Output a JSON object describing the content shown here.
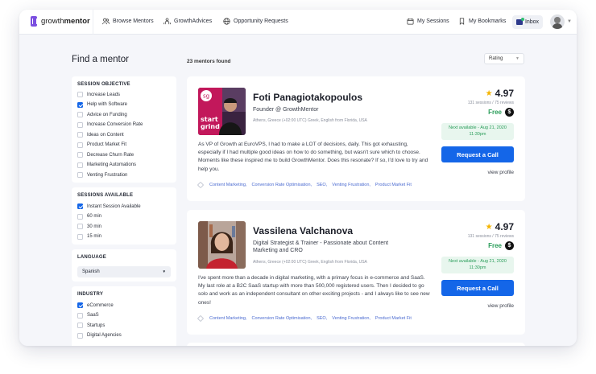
{
  "brand": {
    "name_prefix": "growth",
    "name_suffix": "mentor"
  },
  "nav": {
    "browse": "Browse Mentors",
    "advices": "GrowthAdvices",
    "opportunities": "Opportunity Requests",
    "sessions": "My Sessions",
    "bookmarks": "My Bookmarks",
    "inbox": "Inbox"
  },
  "page": {
    "title": "Find a mentor",
    "count": "23 mentors found",
    "sort": "Rating"
  },
  "filters": {
    "objective": {
      "title": "SESSION OBJECTIVE",
      "options": [
        {
          "label": "Increase Leads",
          "checked": false
        },
        {
          "label": "Help with Software",
          "checked": true
        },
        {
          "label": "Advice on Funding",
          "checked": false
        },
        {
          "label": "Increase Conversion Rate",
          "checked": false
        },
        {
          "label": "Ideas on Content",
          "checked": false
        },
        {
          "label": "Product Market Fit",
          "checked": false
        },
        {
          "label": "Decrease Churn Rate",
          "checked": false
        },
        {
          "label": "Marketing Automations",
          "checked": false
        },
        {
          "label": "Venting Frustration",
          "checked": false
        }
      ]
    },
    "available": {
      "title": "SESSIONS AVAILABLE",
      "options": [
        {
          "label": "Instant Session Available",
          "checked": true
        },
        {
          "label": "60 min",
          "checked": false
        },
        {
          "label": "30 min",
          "checked": false
        },
        {
          "label": "15 min",
          "checked": false
        }
      ]
    },
    "language": {
      "title": "LANGUAGE",
      "value": "Spanish"
    },
    "industry": {
      "title": "INDUSTRY",
      "options": [
        {
          "label": "eCommerce",
          "checked": true
        },
        {
          "label": "SaaS",
          "checked": false
        },
        {
          "label": "Startups",
          "checked": false
        },
        {
          "label": "Digital Agencies",
          "checked": false
        }
      ]
    }
  },
  "mentors": [
    {
      "name": "Foti Panagiotakopoulos",
      "role": "Founder @ GrowthMentor",
      "meta": "Athens, Greece (+02:00 UTC)   Greek, English   from Florida, USA",
      "bio": "As VP of Growth at EuroVPS, I had to make a LOT of decisions, daily. This got exhausting, especially if I had multiple good ideas on how to do something, but wasn't sure which to choose. Moments like these inspired me to build GrowthMentor. Does this resonate? If so, I'd love to try and help you.",
      "rating": "4.97",
      "sessions": "131 sessions / 75 reviews",
      "price": "Free",
      "currency": "$",
      "next_available": "Next available - Aug 21, 2020",
      "next_time": "11:30pm",
      "cta": "Request a Call",
      "profile_link": "view profile",
      "tags": [
        "Content Marketing,",
        "Conversion Rate Optimisation,",
        "SEO,",
        "Venting Frustration,",
        "Product Market Fit"
      ],
      "photo_text": "sg",
      "photo_caption_1": "start",
      "photo_caption_2": "grind"
    },
    {
      "name": "Vassilena Valchanova",
      "role": "Digital Strategist & Trainer - Passionate about Content Marketing and CRO",
      "meta": "Athens, Greece (+02:00 UTC)   Greek, English   from Florida, USA",
      "bio": "I've spent more than a decade in digital marketing, with a primary focus in e-commerce and SaaS. My last role at a B2C SaaS startup with more than 500,000 registered users. Then I decided to go solo and work as an independent consultant on other exciting projects - and I always like to see new ones!",
      "rating": "4.97",
      "sessions": "131 sessions / 75 reviews",
      "price": "Free",
      "currency": "$",
      "next_available": "Next available - Aug 21, 2020",
      "next_time": "11:30pm",
      "cta": "Request a Call",
      "profile_link": "view profile",
      "tags": [
        "Content Marketing,",
        "Conversion Rate Optimisation,",
        "SEO,",
        "Venting Frustration,",
        "Product Market Fit"
      ]
    }
  ]
}
